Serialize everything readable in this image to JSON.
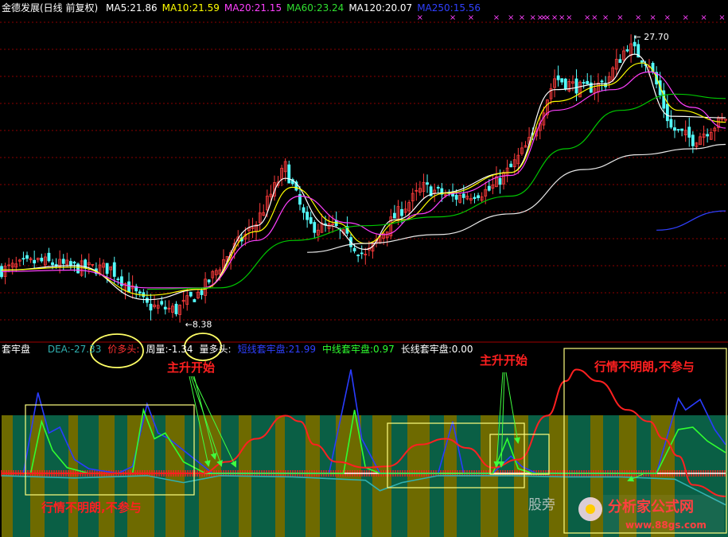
{
  "colors": {
    "background": "#000000",
    "grid": "#8b0000",
    "candle_up": "#ff3c3c",
    "candle_down": "#54ffff",
    "ma5": "#ffffff",
    "ma10": "#ffff00",
    "ma20": "#ff40ff",
    "ma60": "#00c800",
    "ma120": "#e8e8e8",
    "ma250": "#3040ff",
    "band_olive": "#6e6a00",
    "band_green": "#0a5f45",
    "short_line": "#2a3cff",
    "mid_line": "#30ff30",
    "long_line": "#ff2020",
    "dea_line": "#30b0b0",
    "annotation_red": "#ff2020",
    "annotation_yellow": "#ffff66"
  },
  "price_panel": {
    "title": "金德发展(日线 前复权)",
    "ma_labels": [
      {
        "text": "MA5:21.86",
        "color": "#ffffff"
      },
      {
        "text": "MA10:21.59",
        "color": "#ffff00"
      },
      {
        "text": "MA20:21.15",
        "color": "#ff40ff"
      },
      {
        "text": "MA60:23.24",
        "color": "#30e030"
      },
      {
        "text": "MA120:20.07",
        "color": "#ffffff"
      },
      {
        "text": "MA250:15.56",
        "color": "#3040ff"
      }
    ],
    "high_label": "27.70",
    "low_label": "8.38"
  },
  "indicator_panel": {
    "name": "套牢盘",
    "labels": [
      {
        "text": "DEA:-27.33",
        "color": "#30b0b0"
      },
      {
        "text": "价多头:",
        "color": "#ff3030"
      },
      {
        "text": "周量:-1.34",
        "color": "#ffffff"
      },
      {
        "text": "量多头:",
        "color": "#ffffff"
      },
      {
        "text": "短线套牢盘:21.99",
        "color": "#3040ff"
      },
      {
        "text": "中线套牢盘:0.97",
        "color": "#30ff30"
      },
      {
        "text": "长线套牢盘:0.00",
        "color": "#ffffff"
      }
    ]
  },
  "annotations": {
    "main_rise_1": "主升开始",
    "main_rise_2": "主升开始",
    "unclear_top": "行情不明朗,不参与",
    "unclear_bottom": "行情不明朗,不参与"
  },
  "watermark": {
    "text": "股旁",
    "logo_text": "分析家公式网",
    "url": "www.88gs.com"
  },
  "chart_data": [
    {
      "type": "candlestick",
      "title": "金德发展(日线 前复权)",
      "xlabel": "",
      "ylabel": "",
      "ylim": [
        7,
        29
      ],
      "grid": true,
      "n_days": 200,
      "close_path": [
        [
          0,
          11.6
        ],
        [
          10,
          12.2
        ],
        [
          20,
          11.8
        ],
        [
          30,
          11.7
        ],
        [
          40,
          9.2
        ],
        [
          48,
          8.9
        ],
        [
          55,
          10.2
        ],
        [
          62,
          12.6
        ],
        [
          70,
          14.8
        ],
        [
          78,
          18.6
        ],
        [
          84,
          14.6
        ],
        [
          92,
          14.4
        ],
        [
          100,
          12.5
        ],
        [
          108,
          15.2
        ],
        [
          116,
          17.2
        ],
        [
          124,
          16.5
        ],
        [
          134,
          17.0
        ],
        [
          140,
          18.5
        ],
        [
          146,
          20.6
        ],
        [
          152,
          24.6
        ],
        [
          160,
          23.8
        ],
        [
          166,
          24.3
        ],
        [
          172,
          26.8
        ],
        [
          178,
          25.6
        ],
        [
          184,
          21.2
        ],
        [
          190,
          20.4
        ],
        [
          199,
          21.9
        ]
      ],
      "series": [
        {
          "name": "MA5",
          "values": [
            [
              0,
              11.6
            ],
            [
              20,
              11.9
            ],
            [
              40,
              9.6
            ],
            [
              55,
              10.3
            ],
            [
              70,
              14.6
            ],
            [
              78,
              17.8
            ],
            [
              90,
              14.6
            ],
            [
              100,
              13.0
            ],
            [
              108,
              15.0
            ],
            [
              120,
              16.8
            ],
            [
              140,
              18.2
            ],
            [
              152,
              23.8
            ],
            [
              166,
              24.2
            ],
            [
              174,
              26.2
            ],
            [
              184,
              22.0
            ],
            [
              199,
              21.9
            ]
          ]
        },
        {
          "name": "MA10",
          "values": [
            [
              0,
              11.6
            ],
            [
              20,
              11.8
            ],
            [
              40,
              9.9
            ],
            [
              55,
              10.3
            ],
            [
              70,
              14.2
            ],
            [
              80,
              17.2
            ],
            [
              92,
              14.8
            ],
            [
              100,
              13.4
            ],
            [
              110,
              15.0
            ],
            [
              122,
              16.8
            ],
            [
              140,
              18.2
            ],
            [
              152,
              23.0
            ],
            [
              166,
              24.1
            ],
            [
              176,
              25.6
            ],
            [
              186,
              22.4
            ],
            [
              199,
              21.6
            ]
          ]
        },
        {
          "name": "MA20",
          "values": [
            [
              0,
              11.5
            ],
            [
              20,
              11.6
            ],
            [
              40,
              10.4
            ],
            [
              55,
              10.4
            ],
            [
              70,
              13.6
            ],
            [
              82,
              16.6
            ],
            [
              95,
              14.8
            ],
            [
              105,
              14.0
            ],
            [
              115,
              15.4
            ],
            [
              125,
              16.8
            ],
            [
              140,
              18.0
            ],
            [
              152,
              22.4
            ],
            [
              168,
              23.8
            ],
            [
              178,
              25.0
            ],
            [
              190,
              22.6
            ],
            [
              199,
              21.2
            ]
          ]
        },
        {
          "name": "MA60",
          "values": [
            [
              40,
              10.3
            ],
            [
              60,
              10.4
            ],
            [
              80,
              13.6
            ],
            [
              100,
              14.6
            ],
            [
              120,
              15.2
            ],
            [
              140,
              16.6
            ],
            [
              155,
              19.8
            ],
            [
              170,
              22.4
            ],
            [
              185,
              23.5
            ],
            [
              199,
              23.2
            ]
          ]
        },
        {
          "name": "MA120",
          "values": [
            [
              84,
              12.8
            ],
            [
              100,
              13.4
            ],
            [
              120,
              14.0
            ],
            [
              140,
              15.4
            ],
            [
              160,
              18.4
            ],
            [
              175,
              19.4
            ],
            [
              190,
              19.8
            ],
            [
              199,
              20.1
            ]
          ]
        },
        {
          "name": "MA250",
          "values": [
            [
              180,
              14.3
            ],
            [
              199,
              15.6
            ]
          ]
        }
      ]
    },
    {
      "type": "line",
      "title": "套牢盘",
      "xlabel": "",
      "ylabel": "",
      "ylim": [
        -20,
        100
      ],
      "n_days": 200,
      "series": [
        {
          "name": "短线套牢盘",
          "values": [
            [
              0,
              0
            ],
            [
              6,
              0
            ],
            [
              10,
              70
            ],
            [
              13,
              35
            ],
            [
              16,
              40
            ],
            [
              20,
              12
            ],
            [
              24,
              4
            ],
            [
              28,
              2
            ],
            [
              32,
              0
            ],
            [
              36,
              6
            ],
            [
              40,
              60
            ],
            [
              43,
              35
            ],
            [
              46,
              30
            ],
            [
              50,
              20
            ],
            [
              54,
              10
            ],
            [
              58,
              0
            ],
            [
              90,
              0
            ],
            [
              96,
              90
            ],
            [
              99,
              30
            ],
            [
              104,
              0
            ],
            [
              120,
              0
            ],
            [
              124,
              45
            ],
            [
              127,
              0
            ],
            [
              135,
              0
            ],
            [
              140,
              15
            ],
            [
              143,
              6
            ],
            [
              147,
              0
            ],
            [
              180,
              0
            ],
            [
              186,
              65
            ],
            [
              188,
              55
            ],
            [
              192,
              64
            ],
            [
              196,
              38
            ],
            [
              199,
              25
            ]
          ]
        },
        {
          "name": "中线套牢盘",
          "values": [
            [
              0,
              0
            ],
            [
              8,
              0
            ],
            [
              11,
              45
            ],
            [
              14,
              20
            ],
            [
              18,
              5
            ],
            [
              24,
              0
            ],
            [
              36,
              0
            ],
            [
              39,
              55
            ],
            [
              42,
              30
            ],
            [
              45,
              35
            ],
            [
              50,
              10
            ],
            [
              56,
              0
            ],
            [
              94,
              0
            ],
            [
              97,
              55
            ],
            [
              100,
              5
            ],
            [
              104,
              0
            ],
            [
              135,
              0
            ],
            [
              139,
              30
            ],
            [
              142,
              4
            ],
            [
              146,
              0
            ],
            [
              180,
              0
            ],
            [
              186,
              38
            ],
            [
              190,
              40
            ],
            [
              194,
              28
            ],
            [
              199,
              18
            ]
          ]
        },
        {
          "name": "长线套牢盘",
          "values": [
            [
              0,
              0
            ],
            [
              55,
              0
            ],
            [
              62,
              10
            ],
            [
              70,
              30
            ],
            [
              78,
              50
            ],
            [
              82,
              45
            ],
            [
              86,
              25
            ],
            [
              92,
              10
            ],
            [
              100,
              5
            ],
            [
              106,
              6
            ],
            [
              115,
              25
            ],
            [
              122,
              30
            ],
            [
              128,
              22
            ],
            [
              135,
              5
            ],
            [
              142,
              12
            ],
            [
              150,
              50
            ],
            [
              155,
              80
            ],
            [
              158,
              90
            ],
            [
              164,
              80
            ],
            [
              172,
              55
            ],
            [
              178,
              45
            ],
            [
              182,
              30
            ],
            [
              186,
              15
            ],
            [
              190,
              -10
            ],
            [
              199,
              -20
            ]
          ]
        },
        {
          "name": "DEA",
          "values": [
            [
              0,
              -2
            ],
            [
              20,
              -4
            ],
            [
              40,
              -2
            ],
            [
              50,
              -8
            ],
            [
              60,
              -2
            ],
            [
              80,
              -3
            ],
            [
              100,
              -6
            ],
            [
              104,
              -15
            ],
            [
              110,
              -8
            ],
            [
              120,
              -2
            ],
            [
              140,
              -2
            ],
            [
              155,
              -3
            ],
            [
              170,
              -3
            ],
            [
              185,
              -5
            ],
            [
              199,
              -27.33
            ]
          ]
        }
      ]
    }
  ]
}
